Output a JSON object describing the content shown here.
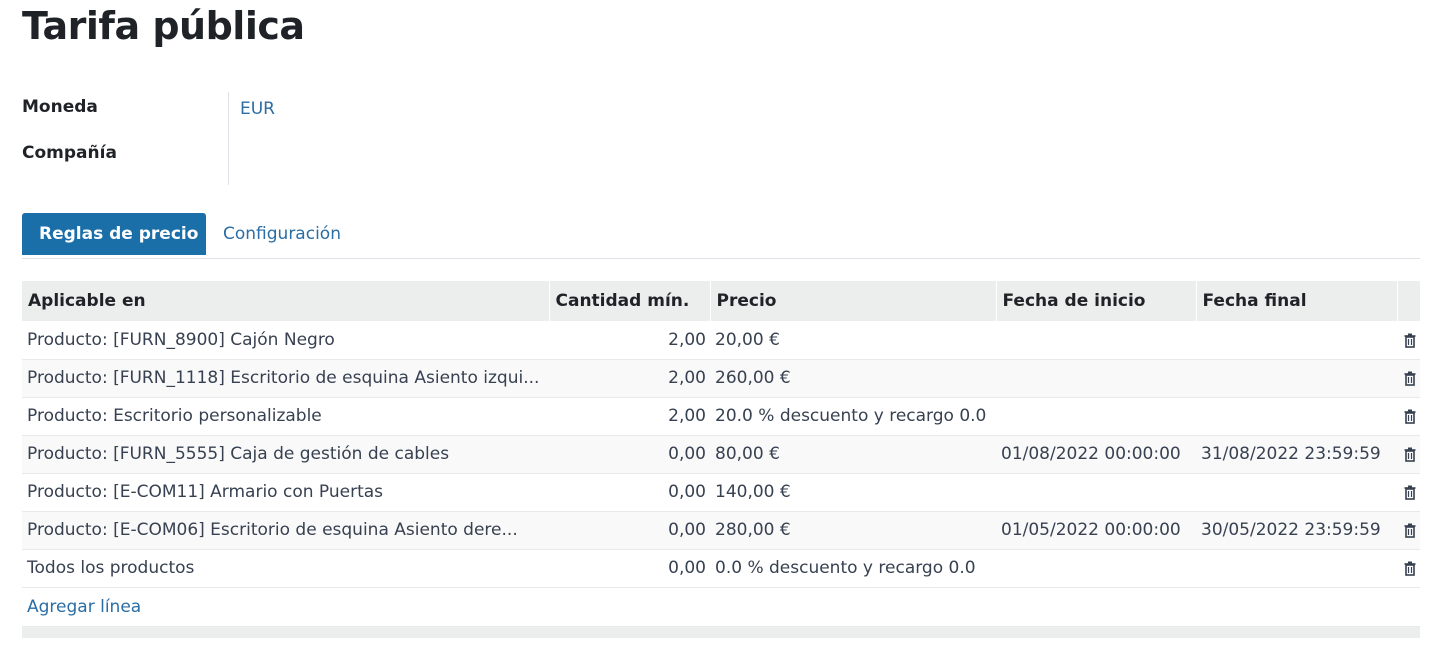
{
  "page": {
    "title": "Tarifa pública"
  },
  "fields": {
    "currency_label": "Moneda",
    "currency_value": "EUR",
    "company_label": "Compañía",
    "company_value": ""
  },
  "tabs": [
    {
      "label": "Reglas de precio",
      "active": true
    },
    {
      "label": "Configuración",
      "active": false
    }
  ],
  "table": {
    "headers": [
      "Aplicable en",
      "Cantidad mín.",
      "Precio",
      "Fecha de inicio",
      "Fecha final"
    ],
    "rows": [
      {
        "applicable": "Producto: [FURN_8900] Cajón Negro",
        "min_qty": "2,00",
        "price": "20,00 €",
        "start": "",
        "end": ""
      },
      {
        "applicable": "Producto: [FURN_1118] Escritorio de esquina Asiento izqui...",
        "min_qty": "2,00",
        "price": "260,00 €",
        "start": "",
        "end": ""
      },
      {
        "applicable": "Producto: Escritorio personalizable",
        "min_qty": "2,00",
        "price": "20.0 % descuento y recargo 0.0",
        "start": "",
        "end": ""
      },
      {
        "applicable": "Producto: [FURN_5555] Caja de gestión de cables",
        "min_qty": "0,00",
        "price": "80,00 €",
        "start": "01/08/2022 00:00:00",
        "end": "31/08/2022 23:59:59"
      },
      {
        "applicable": "Producto: [E-COM11] Armario con Puertas",
        "min_qty": "0,00",
        "price": "140,00 €",
        "start": "",
        "end": ""
      },
      {
        "applicable": "Producto: [E-COM06] Escritorio de esquina Asiento dere...",
        "min_qty": "0,00",
        "price": "280,00 €",
        "start": "01/05/2022 00:00:00",
        "end": "30/05/2022 23:59:59"
      },
      {
        "applicable": "Todos los productos",
        "min_qty": "0,00",
        "price": "0.0 % descuento y recargo 0.0",
        "start": "",
        "end": ""
      }
    ],
    "add_line_label": "Agregar línea",
    "row_action_icon": "trash-icon"
  },
  "colors": {
    "accent": "#1b6fa8",
    "link": "#2a6ea5",
    "header_bg": "#eceded"
  }
}
